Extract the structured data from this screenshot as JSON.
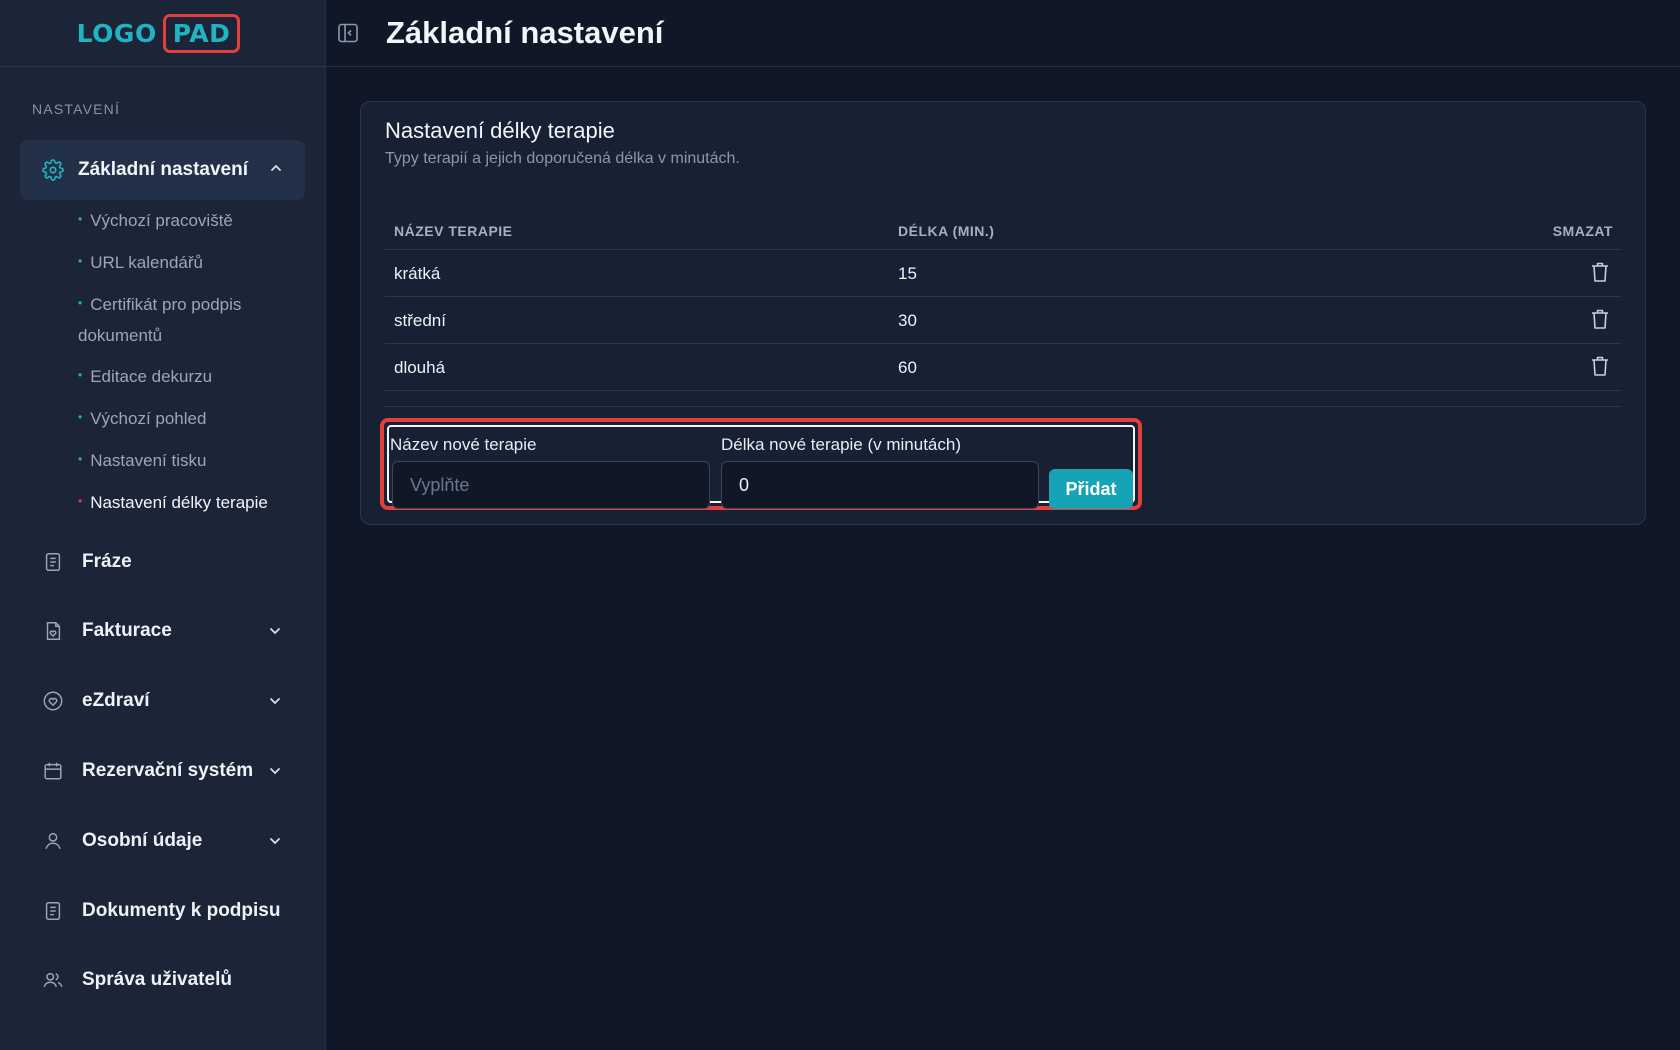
{
  "logo": {
    "part1": "LOGO",
    "part2": "PAD"
  },
  "sidebar": {
    "section_label": "NASTAVENÍ",
    "active_item": {
      "label": "Základní nastavení",
      "icon": "gear-icon"
    },
    "subitems": [
      {
        "label": "Výchozí pracoviště"
      },
      {
        "label": "URL kalendářů"
      },
      {
        "label": "Certifikát pro podpis dokumentů"
      },
      {
        "label": "Editace dekurzu"
      },
      {
        "label": "Výchozí pohled"
      },
      {
        "label": "Nastavení tisku"
      },
      {
        "label": "Nastavení délky terapie",
        "active": true
      }
    ],
    "items": [
      {
        "label": "Fráze",
        "icon": "document-icon"
      },
      {
        "label": "Fakturace",
        "icon": "invoice-icon"
      },
      {
        "label": "eZdraví",
        "icon": "heart-icon"
      },
      {
        "label": "Rezervační systém",
        "icon": "calendar-icon"
      },
      {
        "label": "Osobní údaje",
        "icon": "user-icon"
      },
      {
        "label": "Dokumenty k podpisu",
        "icon": "document-icon"
      },
      {
        "label": "Správa uživatelů",
        "icon": "users-icon"
      }
    ]
  },
  "header": {
    "title": "Základní nastavení"
  },
  "card": {
    "title": "Nastavení délky terapie",
    "subtitle": "Typy terapií a jejich doporučená délka v minutách.",
    "columns": [
      "NÁZEV TERAPIE",
      "DÉLKA (MIN.)",
      "SMAZAT"
    ],
    "rows": [
      {
        "name": "krátká",
        "length": "15"
      },
      {
        "name": "střední",
        "length": "30"
      },
      {
        "name": "dlouhá",
        "length": "60"
      }
    ]
  },
  "form": {
    "name_label": "Název nové terapie",
    "name_placeholder": "Vyplňte",
    "name_value": "",
    "length_label": "Délka nové terapie (v minutách)",
    "length_value": "0",
    "add_button": "Přidat"
  },
  "colors": {
    "accent": "#16a3b6",
    "highlight": "#e2403c",
    "background": "#101828",
    "sidebar": "#1b2537"
  }
}
